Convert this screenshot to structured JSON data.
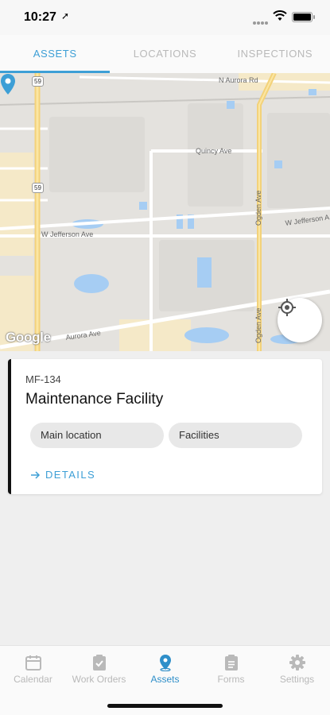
{
  "status_bar": {
    "time": "10:27",
    "location_arrow": "location-arrow-icon"
  },
  "tabs": [
    {
      "label": "ASSETS",
      "active": true
    },
    {
      "label": "LOCATIONS",
      "active": false
    },
    {
      "label": "INSPECTIONS",
      "active": false
    }
  ],
  "map": {
    "streets": {
      "n_aurora_rd": "N Aurora Rd",
      "quincy_ave": "Quincy Ave",
      "ogden_ave": "Ogden Ave",
      "w_jefferson_1": "W Jefferson Ave",
      "w_jefferson_2": "W Jefferson A",
      "aurora_ave": "Aurora Ave"
    },
    "route_shields": [
      "59",
      "59"
    ],
    "logo": "Google",
    "pin_icon": "map-pin-icon",
    "locate_icon": "crosshair-locate-icon"
  },
  "asset": {
    "code": "MF-134",
    "name": "Maintenance Facility",
    "tags": [
      "Main location",
      "Facilities"
    ],
    "details_label": "DETAILS"
  },
  "bottom_nav": [
    {
      "label": "Calendar",
      "icon": "calendar-icon",
      "active": false
    },
    {
      "label": "Work Orders",
      "icon": "clipboard-check-icon",
      "active": false
    },
    {
      "label": "Assets",
      "icon": "map-marker-icon",
      "active": true
    },
    {
      "label": "Forms",
      "icon": "clipboard-list-icon",
      "active": false
    },
    {
      "label": "Settings",
      "icon": "gear-icon",
      "active": false
    }
  ],
  "colors": {
    "accent": "#3d9fd6",
    "active_nav": "#2f8fc9",
    "inactive": "#b9b9b9",
    "card_stripe": "#111111"
  }
}
